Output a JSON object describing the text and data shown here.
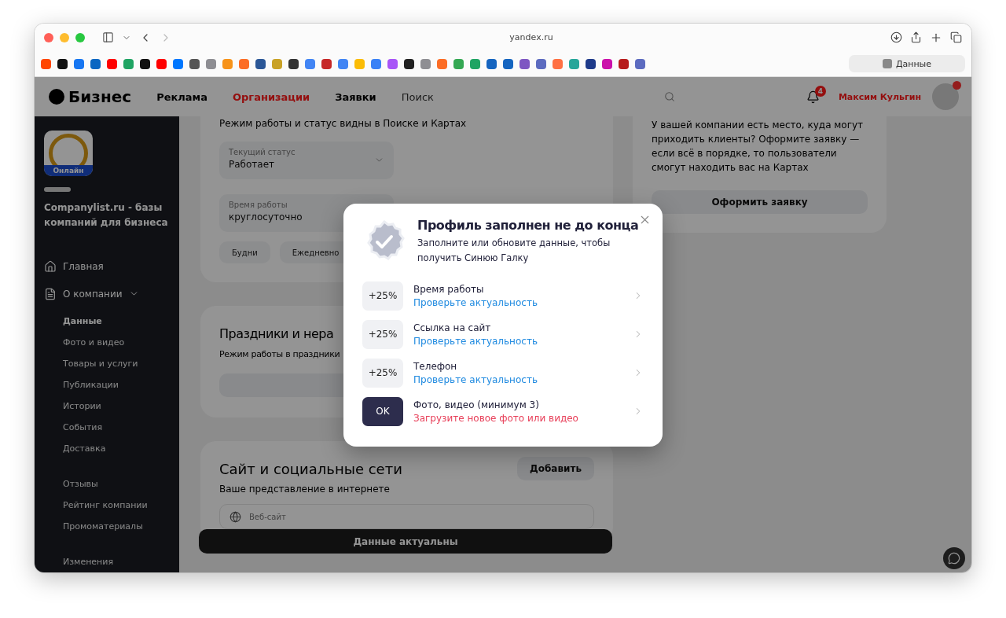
{
  "browser": {
    "url": "yandex.ru",
    "bookmarks": [
      {
        "color": "#ff4500"
      },
      {
        "color": "#111111"
      },
      {
        "color": "#1877f2"
      },
      {
        "color": "#0a66c2"
      },
      {
        "color": "#ff0000"
      },
      {
        "color": "#1fa463"
      },
      {
        "color": "#111111"
      },
      {
        "color": "#ff0000"
      },
      {
        "color": "#0077ff"
      },
      {
        "color": "#555555"
      },
      {
        "color": "#8e8e93"
      },
      {
        "color": "#f7931a"
      },
      {
        "color": "#fc6d26"
      },
      {
        "color": "#2b5797"
      },
      {
        "color": "#c9a227"
      },
      {
        "color": "#333333"
      },
      {
        "color": "#4285f4"
      },
      {
        "color": "#c62828"
      },
      {
        "color": "#4285f4"
      },
      {
        "color": "#fbbc05"
      },
      {
        "color": "#3b82f6"
      },
      {
        "color": "#a855f7"
      },
      {
        "color": "#222222"
      },
      {
        "color": "#8e8e93"
      },
      {
        "color": "#fc6d26"
      },
      {
        "color": "#34a853"
      },
      {
        "color": "#1fa463"
      },
      {
        "color": "#1565c0"
      },
      {
        "color": "#1565c0"
      },
      {
        "color": "#7e57c2"
      },
      {
        "color": "#5c6bc0"
      },
      {
        "color": "#ff7043"
      },
      {
        "color": "#26a69a"
      },
      {
        "color": "#1e3a8a"
      },
      {
        "color": "#cb11ab"
      },
      {
        "color": "#b71c1c"
      },
      {
        "color": "#5c6bc0"
      }
    ],
    "tab": {
      "label": "Данные"
    }
  },
  "header": {
    "logo": "Бизнес",
    "nav": [
      {
        "label": "Реклама",
        "selected": false
      },
      {
        "label": "Организации",
        "selected": true
      },
      {
        "label": "Заявки",
        "selected": false
      }
    ],
    "search": {
      "placeholder": "Поиск"
    },
    "notifications": "4",
    "user": "Максим Кульгин"
  },
  "sidebar": {
    "status": "Онлайн",
    "company": "Companylist.ru - базы компаний для бизнеса",
    "items": [
      {
        "label": "Главная",
        "selected": false
      },
      {
        "label": "О компании",
        "selected": false,
        "expanded": true,
        "children": [
          {
            "label": "Данные",
            "selected": true
          },
          {
            "label": "Фото и видео",
            "selected": false
          },
          {
            "label": "Товары и услуги",
            "selected": false
          },
          {
            "label": "Публикации",
            "selected": false
          },
          {
            "label": "Истории",
            "selected": false
          },
          {
            "label": "События",
            "selected": false
          },
          {
            "label": "Доставка",
            "selected": false
          }
        ]
      }
    ],
    "more": [
      {
        "label": "Отзывы"
      },
      {
        "label": "Рейтинг компании"
      },
      {
        "label": "Промоматериалы"
      }
    ],
    "footer": "Изменения"
  },
  "schedule": {
    "subtitle": "Режим работы и статус видны в Поиске и Картах",
    "status_field": {
      "label": "Текущий статус",
      "value": "Работает"
    },
    "hours_field": {
      "label": "Время работы",
      "value": "круглосуточно"
    },
    "chips": [
      "Будни",
      "Ежедневно"
    ]
  },
  "holidays": {
    "title": "Праздники и нера",
    "subtitle": "Режим работы в праздники"
  },
  "sites": {
    "title": "Сайт и социальные сети",
    "button": "Добавить",
    "subtitle": "Ваше представление в интернете",
    "field": {
      "label": "Веб-сайт"
    }
  },
  "confirm_button": "Данные актуальны",
  "side_card": {
    "text": "У вашей компании есть место, куда могут приходить клиенты? Оформите заявку — если всё в порядке, то пользователи смогут находить вас на Картах",
    "button": "Оформить заявку"
  },
  "modal": {
    "title": "Профиль заполнен не до конца",
    "subtitle": "Заполните или обновите данные, чтобы получить Синюю Галку",
    "items": [
      {
        "kind": "pending",
        "badge": "+25%",
        "title": "Время работы",
        "action": "Проверьте актуальность"
      },
      {
        "kind": "pending",
        "badge": "+25%",
        "title": "Ссылка на сайт",
        "action": "Проверьте актуальность"
      },
      {
        "kind": "pending",
        "badge": "+25%",
        "title": "Телефон",
        "action": "Проверьте актуальность"
      },
      {
        "kind": "done",
        "badge": "OK",
        "title": "Фото, видео (минимум 3)",
        "action": "Загрузите новое фото или видео"
      }
    ]
  }
}
